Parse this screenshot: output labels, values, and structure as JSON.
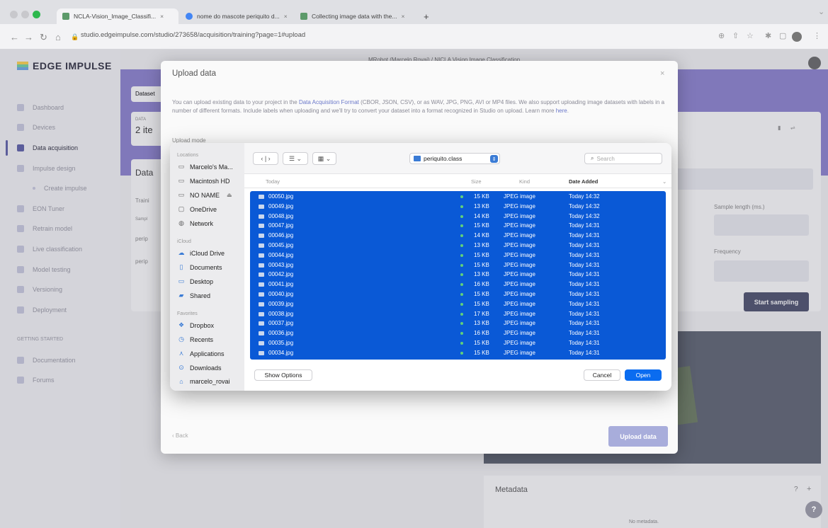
{
  "browser": {
    "tabs": [
      {
        "title": "NCLA-Vision_Image_Classifi...",
        "favicon_color": "#5c9a6a"
      },
      {
        "title": "nome do mascote periquito d...",
        "favicon_color": "#4285f4"
      },
      {
        "title": "Collecting image data with the...",
        "favicon_color": "#5c9a6a"
      }
    ],
    "new_tab": "+",
    "url": "studio.edgeimpulse.com/studio/273658/acquisition/training?page=1#upload"
  },
  "app": {
    "logo": "EDGE IMPULSE",
    "top_line": "MRobot (Marcelo Rovai) / NICLA Vision Image Classification",
    "sidebar": [
      {
        "label": "Dashboard"
      },
      {
        "label": "Devices"
      },
      {
        "label": "Data acquisition"
      },
      {
        "label": "Impulse design"
      },
      {
        "label": "Create impulse"
      },
      {
        "label": "EON Tuner"
      },
      {
        "label": "Retrain model"
      },
      {
        "label": "Live classification"
      },
      {
        "label": "Model testing"
      },
      {
        "label": "Versioning"
      },
      {
        "label": "Deployment"
      }
    ],
    "getting_started": "GETTING STARTED",
    "getting_started_items": [
      {
        "label": "Documentation"
      },
      {
        "label": "Forums"
      }
    ],
    "bg": {
      "dataset_tab": "Dataset",
      "data_label": "DATA",
      "items_count": "2 ite",
      "data_heading": "Data",
      "train_label": "Traini",
      "sample_label": "Sampl",
      "row1": "perip",
      "row2": "perip",
      "sample_length_label": "Sample length (ms.)",
      "frequency_label": "Frequency",
      "start_sampling": "Start sampling",
      "metadata_title": "Metadata",
      "metadata_help": "?",
      "metadata_add": "+",
      "no_metadata": "No metadata."
    }
  },
  "modal": {
    "title": "Upload data",
    "close": "×",
    "desc_part1": "You can upload existing data to your project in the ",
    "desc_link1": "Data Acquisition Format",
    "desc_part2": " (CBOR, JSON, CSV), or as WAV, JPG, PNG, AVI or MP4 files. We also support uploading image datasets with labels in a number of different formats. Include labels when uploading and we'll try to convert your dataset into a format recognized in Studio on upload. Learn more ",
    "desc_link2": "here",
    "desc_part3": ".",
    "upload_mode": "Upload mode",
    "back": "‹ Back",
    "upload_button": "Upload data"
  },
  "finder": {
    "locations_label": "Locations",
    "locations": [
      {
        "label": "Marcelo's Ma...",
        "icon": "laptop-icon"
      },
      {
        "label": "Macintosh HD",
        "icon": "disk-icon"
      },
      {
        "label": "NO NAME",
        "icon": "disk-icon"
      },
      {
        "label": "OneDrive",
        "icon": "file-icon"
      },
      {
        "label": "Network",
        "icon": "globe-icon"
      }
    ],
    "eject": "⏏",
    "icloud_label": "iCloud",
    "icloud": [
      {
        "label": "iCloud Drive",
        "icon": "cloud-icon"
      },
      {
        "label": "Documents",
        "icon": "document-icon"
      },
      {
        "label": "Desktop",
        "icon": "desktop-icon"
      },
      {
        "label": "Shared",
        "icon": "folder-icon"
      }
    ],
    "favorites_label": "Favorites",
    "favorites": [
      {
        "label": "Dropbox",
        "icon": "dropbox-icon"
      },
      {
        "label": "Recents",
        "icon": "clock-icon"
      },
      {
        "label": "Applications",
        "icon": "applications-icon"
      },
      {
        "label": "Downloads",
        "icon": "download-icon"
      },
      {
        "label": "marcelo_rovai",
        "icon": "home-icon"
      }
    ],
    "folder": "periquito.class",
    "search_placeholder": "Search",
    "columns": {
      "name": "Today",
      "size": "Size",
      "kind": "Kind",
      "date": "Date Added"
    },
    "files": [
      {
        "name": "00050.jpg",
        "size": "15 KB",
        "kind": "JPEG image",
        "date": "Today 14:32"
      },
      {
        "name": "00049.jpg",
        "size": "13 KB",
        "kind": "JPEG image",
        "date": "Today 14:32"
      },
      {
        "name": "00048.jpg",
        "size": "14 KB",
        "kind": "JPEG image",
        "date": "Today 14:32"
      },
      {
        "name": "00047.jpg",
        "size": "15 KB",
        "kind": "JPEG image",
        "date": "Today 14:31"
      },
      {
        "name": "00046.jpg",
        "size": "14 KB",
        "kind": "JPEG image",
        "date": "Today 14:31"
      },
      {
        "name": "00045.jpg",
        "size": "13 KB",
        "kind": "JPEG image",
        "date": "Today 14:31"
      },
      {
        "name": "00044.jpg",
        "size": "15 KB",
        "kind": "JPEG image",
        "date": "Today 14:31"
      },
      {
        "name": "00043.jpg",
        "size": "15 KB",
        "kind": "JPEG image",
        "date": "Today 14:31"
      },
      {
        "name": "00042.jpg",
        "size": "13 KB",
        "kind": "JPEG image",
        "date": "Today 14:31"
      },
      {
        "name": "00041.jpg",
        "size": "16 KB",
        "kind": "JPEG image",
        "date": "Today 14:31"
      },
      {
        "name": "00040.jpg",
        "size": "15 KB",
        "kind": "JPEG image",
        "date": "Today 14:31"
      },
      {
        "name": "00039.jpg",
        "size": "15 KB",
        "kind": "JPEG image",
        "date": "Today 14:31"
      },
      {
        "name": "00038.jpg",
        "size": "17 KB",
        "kind": "JPEG image",
        "date": "Today 14:31"
      },
      {
        "name": "00037.jpg",
        "size": "13 KB",
        "kind": "JPEG image",
        "date": "Today 14:31"
      },
      {
        "name": "00036.jpg",
        "size": "16 KB",
        "kind": "JPEG image",
        "date": "Today 14:31"
      },
      {
        "name": "00035.jpg",
        "size": "15 KB",
        "kind": "JPEG image",
        "date": "Today 14:31"
      },
      {
        "name": "00034.jpg",
        "size": "15 KB",
        "kind": "JPEG image",
        "date": "Today 14:31"
      }
    ],
    "show_options": "Show Options",
    "cancel": "Cancel",
    "open": "Open",
    "selection_color": "#0a59d6"
  }
}
